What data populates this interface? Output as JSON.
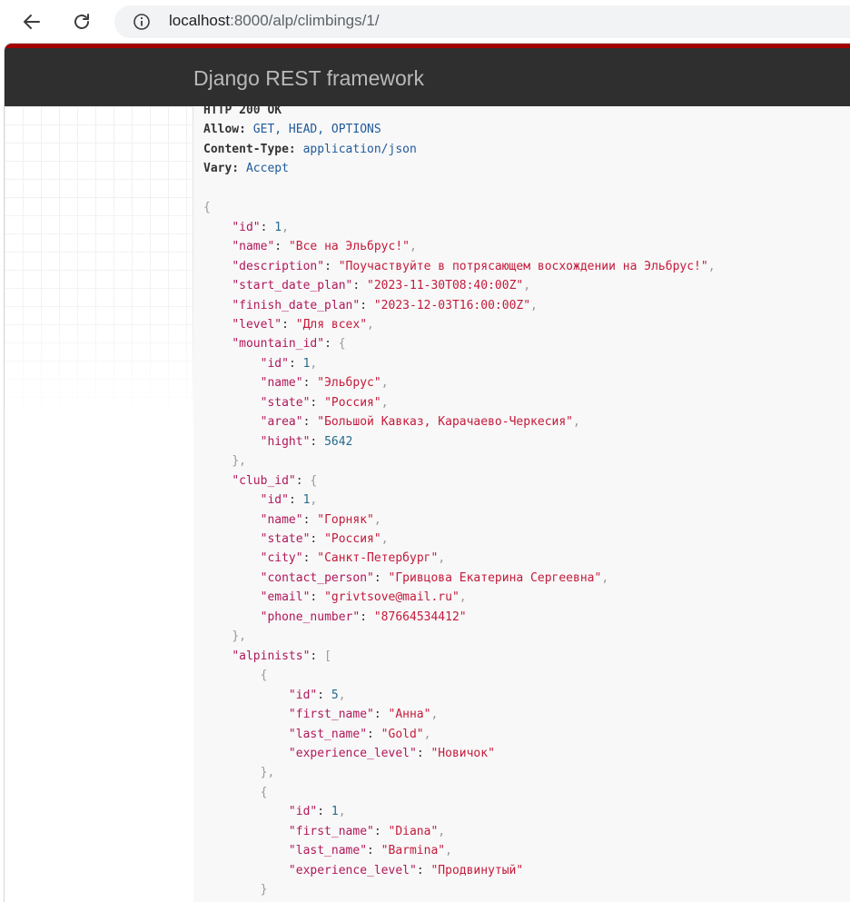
{
  "browser": {
    "url_host": "localhost",
    "url_path": ":8000/alp/climbings/1/"
  },
  "navbar": {
    "brand": "Django REST framework"
  },
  "response": {
    "status_partial": "HTTP 200 OK",
    "headers": [
      {
        "name": "Allow:",
        "value": "GET, HEAD, OPTIONS"
      },
      {
        "name": "Content-Type:",
        "value": "application/json"
      },
      {
        "name": "Vary:",
        "value": "Accept"
      }
    ],
    "body": {
      "id": 1,
      "name": "Все на Эльбрус!",
      "description": "Поучаствуйте в потрясающем восхождении на Эльбрус!",
      "start_date_plan": "2023-11-30T08:40:00Z",
      "finish_date_plan": "2023-12-03T16:00:00Z",
      "level": "Для всех",
      "mountain_id": {
        "id": 1,
        "name": "Эльбрус",
        "state": "Россия",
        "area": "Большой Кавказ, Карачаево-Черкесия",
        "hight": 5642
      },
      "club_id": {
        "id": 1,
        "name": "Горняк",
        "state": "Россия",
        "city": "Санкт-Петербург",
        "contact_person": "Гривцова Екатерина Сергеевна",
        "email": "grivtsove@mail.ru",
        "phone_number": "87664534412"
      },
      "alpinists": [
        {
          "id": 5,
          "first_name": "Анна",
          "last_name": "Gold",
          "experience_level": "Новичок"
        },
        {
          "id": 1,
          "first_name": "Diana",
          "last_name": "Barmina",
          "experience_level": "Продвинутый"
        }
      ]
    }
  },
  "colors": {
    "navbar_bg": "#2f2f2f",
    "navbar_accent": "#a30000",
    "key": "#b0185a",
    "string": "#c41a3b",
    "number": "#236a8e"
  },
  "icons": [
    "back-arrow-icon",
    "reload-icon",
    "info-icon"
  ]
}
